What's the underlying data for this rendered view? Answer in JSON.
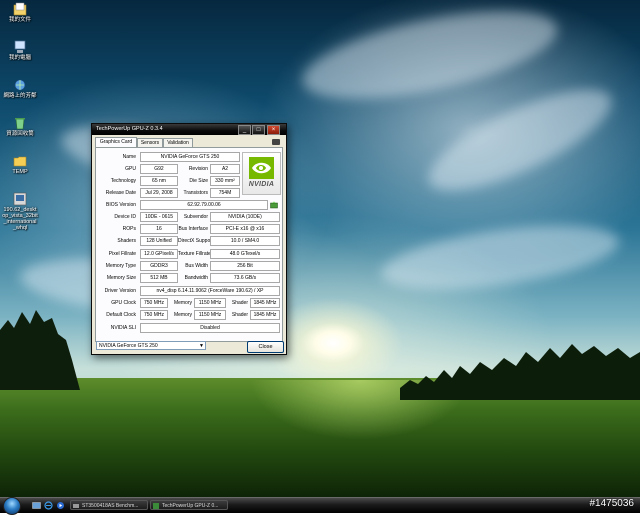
{
  "desktop": {
    "icons": [
      {
        "label": "我的文件"
      },
      {
        "label": "我的電腦"
      },
      {
        "label": "網路上的芳鄰"
      },
      {
        "label": "資源回收筒"
      },
      {
        "label": "TEMP"
      },
      {
        "label": "190.62_desktop_vista_32bit_international_whql"
      }
    ]
  },
  "window": {
    "title": "TechPowerUp GPU-Z 0.3.4",
    "tabs": [
      "Graphics Card",
      "Sensors",
      "Validation"
    ],
    "logo_text": "NVIDIA",
    "fields": {
      "name": {
        "label": "Name",
        "value": "NVIDIA GeForce GTS 250"
      },
      "gpu": {
        "label": "GPU",
        "value": "G92"
      },
      "revision": {
        "label": "Revision",
        "value": "A2"
      },
      "technology": {
        "label": "Technology",
        "value": "65 nm"
      },
      "die_size": {
        "label": "Die Size",
        "value": "330 mm²"
      },
      "release_date": {
        "label": "Release Date",
        "value": "Jul 29, 2008"
      },
      "transistors": {
        "label": "Transistors",
        "value": "754M"
      },
      "bios_version": {
        "label": "BIOS Version",
        "value": "62.92.79.00.06"
      },
      "device_id": {
        "label": "Device ID",
        "value": "10DE - 0615"
      },
      "subvendor": {
        "label": "Subvendor",
        "value": "NVIDIA (10DE)"
      },
      "rops": {
        "label": "ROPs",
        "value": "16"
      },
      "bus_interface": {
        "label": "Bus Interface",
        "value": "PCI-E x16 @ x16"
      },
      "shaders": {
        "label": "Shaders",
        "value": "128 Unified"
      },
      "directx": {
        "label": "DirectX Support",
        "value": "10.0 / SM4.0"
      },
      "pixel_fillrate": {
        "label": "Pixel Fillrate",
        "value": "12.0 GPixel/s"
      },
      "texture_fillrate": {
        "label": "Texture Fillrate",
        "value": "48.0 GTexel/s"
      },
      "memory_type": {
        "label": "Memory Type",
        "value": "GDDR3"
      },
      "bus_width": {
        "label": "Bus Width",
        "value": "256 Bit"
      },
      "memory_size": {
        "label": "Memory Size",
        "value": "512 MB"
      },
      "bandwidth": {
        "label": "Bandwidth",
        "value": "73.6 GB/s"
      },
      "driver_version": {
        "label": "Driver Version",
        "value": "nv4_disp 6.14.11.9062 (ForceWare 190.62) / XP"
      },
      "gpu_clock": {
        "label": "GPU Clock",
        "gpu": "750 MHz",
        "memory_label": "Memory",
        "memory": "1150 MHz",
        "shader_label": "Shader",
        "shader": "1845 MHz"
      },
      "default_clock": {
        "label": "Default Clock",
        "gpu": "750 MHz",
        "memory_label": "Memory",
        "memory": "1150 MHz",
        "shader_label": "Shader",
        "shader": "1845 MHz"
      },
      "sli": {
        "label": "NVIDIA SLI",
        "value": "Disabled"
      }
    },
    "gpu_select": "NVIDIA GeForce GTS 250",
    "close_button": "Close"
  },
  "taskbar": {
    "buttons": [
      {
        "label": "ST3500418AS Benchm..."
      },
      {
        "label": "TechPowerUp GPU-Z 0..."
      }
    ]
  },
  "watermark": "#1475036",
  "colors": {
    "nvidia_green": "#76b900",
    "titlebar": "#0a0a0a",
    "panel": "#fcfcfe"
  }
}
